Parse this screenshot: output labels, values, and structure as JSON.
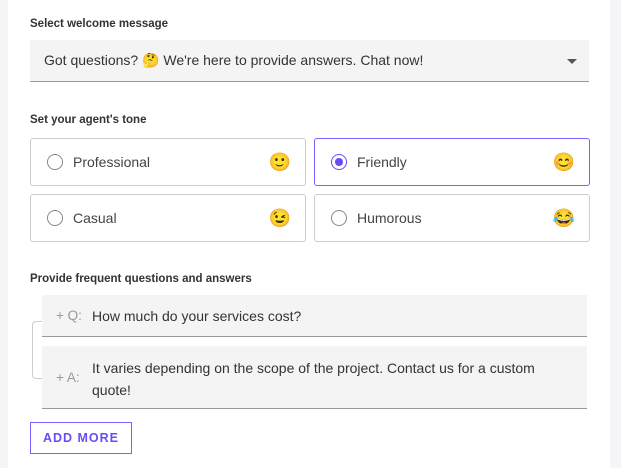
{
  "welcome": {
    "label": "Select welcome message",
    "value": "Got questions? 🤔 We're here to provide answers. Chat now!"
  },
  "tone": {
    "label": "Set your agent's tone",
    "options": [
      {
        "label": "Professional",
        "icon": "🙂",
        "selected": false
      },
      {
        "label": "Friendly",
        "icon": "😊",
        "selected": true
      },
      {
        "label": "Casual",
        "icon": "😉",
        "selected": false
      },
      {
        "label": "Humorous",
        "icon": "😂",
        "selected": false
      }
    ]
  },
  "faq": {
    "label": "Provide frequent questions and answers",
    "q_prefix": "+ Q:",
    "a_prefix": "+ A:",
    "question": "How much do your services cost?",
    "answer": "It varies depending on the scope of the project. Contact us for a custom quote!"
  },
  "add_more": "ADD MORE",
  "colors": {
    "accent": "#6a4cf5"
  }
}
